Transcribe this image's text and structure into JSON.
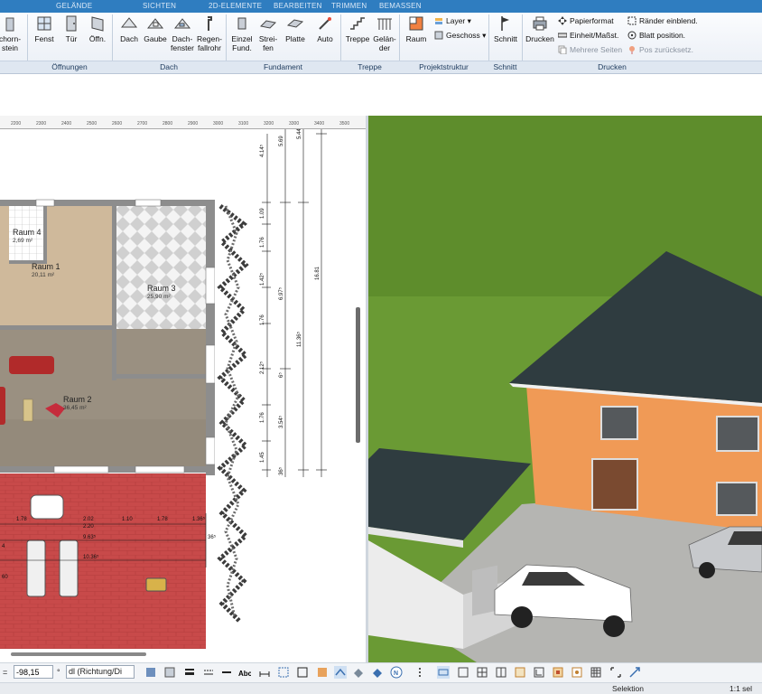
{
  "ribbon": {
    "tabs": [
      "GELÄNDE",
      "SICHTEN",
      "2D-ELEMENTE",
      "BEARBEITEN",
      "TRIMMEN",
      "BEMASSEN"
    ],
    "buttons": {
      "schornstein": "chorn-\nstein",
      "fenster": "Fenst",
      "tuer": "Tür",
      "oeffnung": "Öffn.",
      "dach": "Dach",
      "gaube": "Gaube",
      "dachfenster": "Dach-\nfenster",
      "regenfallrohr": "Regen-\nfallrohr",
      "einzelfundament": "Einzel\nFund.",
      "streifenfundament": "Strei-\nfen",
      "platte": "Platte",
      "auto": "Auto",
      "treppe": "Treppe",
      "gelaender": "Gelän-\nder",
      "raum": "Raum",
      "layer": "Layer",
      "geschoss": "Geschoss",
      "schnitt": "Schnitt",
      "drucken": "Drucken",
      "papierformat": "Papierformat",
      "einheit": "Einheit/Maßst.",
      "mehrere_seiten": "Mehrere Seiten",
      "raender": "Ränder einblend.",
      "blatt_position": "Blatt position.",
      "pos_zurueck": "Pos zurücksetz."
    },
    "groups": [
      "Öffnungen",
      "Dach",
      "Fundament",
      "Treppe",
      "Projektstruktur",
      "Schnitt",
      "Drucken"
    ]
  },
  "plan": {
    "ruler_ticks": [
      "2200",
      "2300",
      "2400",
      "2500",
      "2600",
      "2700",
      "2800",
      "2900",
      "3000",
      "3100",
      "3200",
      "3300",
      "3400",
      "3500"
    ],
    "rooms": [
      {
        "name": "Raum 4",
        "area": "2,69 m²"
      },
      {
        "name": "Raum 1",
        "area": "20,11 m²"
      },
      {
        "name": "Raum 3",
        "area": "25,90 m²"
      },
      {
        "name": "Raum 2",
        "area": "36,45 m²"
      }
    ],
    "vertical_dims": [
      "4.14⁵",
      "5.69",
      "5.44",
      "1.09",
      "1.76",
      "1.42⁵",
      "6.97⁵",
      "11.36⁵",
      "16.81",
      "1.76",
      "2.12⁵",
      "1.76",
      "3.54⁵",
      "1.45",
      "36⁵",
      "6⁵"
    ],
    "horizontal_dims": [
      "1.78",
      "2.02",
      "1.10",
      "1.78",
      "1.36⁵",
      "2.20",
      "9.63⁵",
      "10.36⁵",
      "36⁵",
      "4",
      "60"
    ]
  },
  "bottombar": {
    "coord_label": "=",
    "coord_value": "-98,15",
    "degree": "°",
    "dl_value": "dl (Richtung/Di"
  },
  "status": {
    "mode": "Selektion",
    "scale": "1:1 sel"
  },
  "colors": {
    "ribbon_tab_bg": "#2f7dc0",
    "wall": "#8d8d8d",
    "facade": "#f09a56",
    "roof": "#2f3c40",
    "grass": "#6a9a34"
  }
}
